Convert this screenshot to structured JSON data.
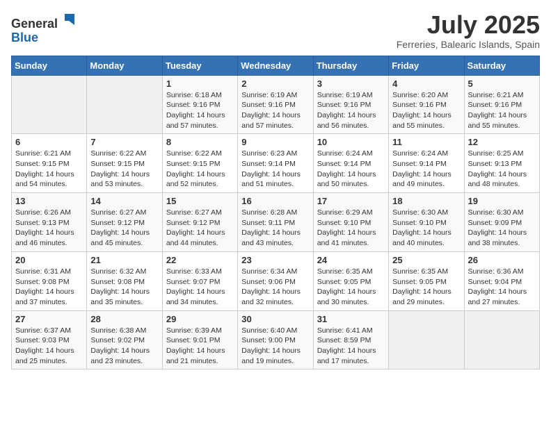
{
  "header": {
    "logo_general": "General",
    "logo_blue": "Blue",
    "month_title": "July 2025",
    "subtitle": "Ferreries, Balearic Islands, Spain"
  },
  "weekdays": [
    "Sunday",
    "Monday",
    "Tuesday",
    "Wednesday",
    "Thursday",
    "Friday",
    "Saturday"
  ],
  "weeks": [
    [
      {
        "day": "",
        "sunrise": "",
        "sunset": "",
        "daylight": ""
      },
      {
        "day": "",
        "sunrise": "",
        "sunset": "",
        "daylight": ""
      },
      {
        "day": "1",
        "sunrise": "Sunrise: 6:18 AM",
        "sunset": "Sunset: 9:16 PM",
        "daylight": "Daylight: 14 hours and 57 minutes."
      },
      {
        "day": "2",
        "sunrise": "Sunrise: 6:19 AM",
        "sunset": "Sunset: 9:16 PM",
        "daylight": "Daylight: 14 hours and 57 minutes."
      },
      {
        "day": "3",
        "sunrise": "Sunrise: 6:19 AM",
        "sunset": "Sunset: 9:16 PM",
        "daylight": "Daylight: 14 hours and 56 minutes."
      },
      {
        "day": "4",
        "sunrise": "Sunrise: 6:20 AM",
        "sunset": "Sunset: 9:16 PM",
        "daylight": "Daylight: 14 hours and 55 minutes."
      },
      {
        "day": "5",
        "sunrise": "Sunrise: 6:21 AM",
        "sunset": "Sunset: 9:16 PM",
        "daylight": "Daylight: 14 hours and 55 minutes."
      }
    ],
    [
      {
        "day": "6",
        "sunrise": "Sunrise: 6:21 AM",
        "sunset": "Sunset: 9:15 PM",
        "daylight": "Daylight: 14 hours and 54 minutes."
      },
      {
        "day": "7",
        "sunrise": "Sunrise: 6:22 AM",
        "sunset": "Sunset: 9:15 PM",
        "daylight": "Daylight: 14 hours and 53 minutes."
      },
      {
        "day": "8",
        "sunrise": "Sunrise: 6:22 AM",
        "sunset": "Sunset: 9:15 PM",
        "daylight": "Daylight: 14 hours and 52 minutes."
      },
      {
        "day": "9",
        "sunrise": "Sunrise: 6:23 AM",
        "sunset": "Sunset: 9:14 PM",
        "daylight": "Daylight: 14 hours and 51 minutes."
      },
      {
        "day": "10",
        "sunrise": "Sunrise: 6:24 AM",
        "sunset": "Sunset: 9:14 PM",
        "daylight": "Daylight: 14 hours and 50 minutes."
      },
      {
        "day": "11",
        "sunrise": "Sunrise: 6:24 AM",
        "sunset": "Sunset: 9:14 PM",
        "daylight": "Daylight: 14 hours and 49 minutes."
      },
      {
        "day": "12",
        "sunrise": "Sunrise: 6:25 AM",
        "sunset": "Sunset: 9:13 PM",
        "daylight": "Daylight: 14 hours and 48 minutes."
      }
    ],
    [
      {
        "day": "13",
        "sunrise": "Sunrise: 6:26 AM",
        "sunset": "Sunset: 9:13 PM",
        "daylight": "Daylight: 14 hours and 46 minutes."
      },
      {
        "day": "14",
        "sunrise": "Sunrise: 6:27 AM",
        "sunset": "Sunset: 9:12 PM",
        "daylight": "Daylight: 14 hours and 45 minutes."
      },
      {
        "day": "15",
        "sunrise": "Sunrise: 6:27 AM",
        "sunset": "Sunset: 9:12 PM",
        "daylight": "Daylight: 14 hours and 44 minutes."
      },
      {
        "day": "16",
        "sunrise": "Sunrise: 6:28 AM",
        "sunset": "Sunset: 9:11 PM",
        "daylight": "Daylight: 14 hours and 43 minutes."
      },
      {
        "day": "17",
        "sunrise": "Sunrise: 6:29 AM",
        "sunset": "Sunset: 9:10 PM",
        "daylight": "Daylight: 14 hours and 41 minutes."
      },
      {
        "day": "18",
        "sunrise": "Sunrise: 6:30 AM",
        "sunset": "Sunset: 9:10 PM",
        "daylight": "Daylight: 14 hours and 40 minutes."
      },
      {
        "day": "19",
        "sunrise": "Sunrise: 6:30 AM",
        "sunset": "Sunset: 9:09 PM",
        "daylight": "Daylight: 14 hours and 38 minutes."
      }
    ],
    [
      {
        "day": "20",
        "sunrise": "Sunrise: 6:31 AM",
        "sunset": "Sunset: 9:08 PM",
        "daylight": "Daylight: 14 hours and 37 minutes."
      },
      {
        "day": "21",
        "sunrise": "Sunrise: 6:32 AM",
        "sunset": "Sunset: 9:08 PM",
        "daylight": "Daylight: 14 hours and 35 minutes."
      },
      {
        "day": "22",
        "sunrise": "Sunrise: 6:33 AM",
        "sunset": "Sunset: 9:07 PM",
        "daylight": "Daylight: 14 hours and 34 minutes."
      },
      {
        "day": "23",
        "sunrise": "Sunrise: 6:34 AM",
        "sunset": "Sunset: 9:06 PM",
        "daylight": "Daylight: 14 hours and 32 minutes."
      },
      {
        "day": "24",
        "sunrise": "Sunrise: 6:35 AM",
        "sunset": "Sunset: 9:05 PM",
        "daylight": "Daylight: 14 hours and 30 minutes."
      },
      {
        "day": "25",
        "sunrise": "Sunrise: 6:35 AM",
        "sunset": "Sunset: 9:05 PM",
        "daylight": "Daylight: 14 hours and 29 minutes."
      },
      {
        "day": "26",
        "sunrise": "Sunrise: 6:36 AM",
        "sunset": "Sunset: 9:04 PM",
        "daylight": "Daylight: 14 hours and 27 minutes."
      }
    ],
    [
      {
        "day": "27",
        "sunrise": "Sunrise: 6:37 AM",
        "sunset": "Sunset: 9:03 PM",
        "daylight": "Daylight: 14 hours and 25 minutes."
      },
      {
        "day": "28",
        "sunrise": "Sunrise: 6:38 AM",
        "sunset": "Sunset: 9:02 PM",
        "daylight": "Daylight: 14 hours and 23 minutes."
      },
      {
        "day": "29",
        "sunrise": "Sunrise: 6:39 AM",
        "sunset": "Sunset: 9:01 PM",
        "daylight": "Daylight: 14 hours and 21 minutes."
      },
      {
        "day": "30",
        "sunrise": "Sunrise: 6:40 AM",
        "sunset": "Sunset: 9:00 PM",
        "daylight": "Daylight: 14 hours and 19 minutes."
      },
      {
        "day": "31",
        "sunrise": "Sunrise: 6:41 AM",
        "sunset": "Sunset: 8:59 PM",
        "daylight": "Daylight: 14 hours and 17 minutes."
      },
      {
        "day": "",
        "sunrise": "",
        "sunset": "",
        "daylight": ""
      },
      {
        "day": "",
        "sunrise": "",
        "sunset": "",
        "daylight": ""
      }
    ]
  ]
}
